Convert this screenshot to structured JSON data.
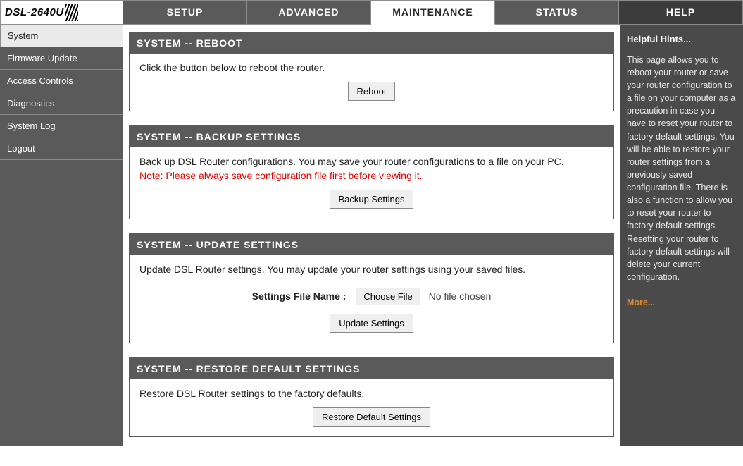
{
  "logo": {
    "model": "DSL-2640U"
  },
  "tabs": {
    "setup": "SETUP",
    "advanced": "ADVANCED",
    "maintenance": "MAINTENANCE",
    "status": "STATUS",
    "help": "HELP"
  },
  "sidebar": {
    "items": [
      {
        "label": "System"
      },
      {
        "label": "Firmware Update"
      },
      {
        "label": "Access Controls"
      },
      {
        "label": "Diagnostics"
      },
      {
        "label": "System Log"
      },
      {
        "label": "Logout"
      }
    ]
  },
  "panels": {
    "reboot": {
      "title": "SYSTEM -- REBOOT",
      "text": "Click the button below to reboot the router.",
      "button": "Reboot"
    },
    "backup": {
      "title": "SYSTEM -- BACKUP SETTINGS",
      "text": "Back up DSL Router configurations. You may save your router configurations to a file on your PC.",
      "note": "Note: Please always save configuration file first before viewing it.",
      "button": "Backup Settings"
    },
    "update": {
      "title": "SYSTEM -- UPDATE SETTINGS",
      "text": "Update DSL Router settings. You may update your router settings using your saved files.",
      "file_label": "Settings File Name :",
      "choose_button": "Choose File",
      "file_status": "No file chosen",
      "button": "Update Settings"
    },
    "restore": {
      "title": "SYSTEM -- RESTORE DEFAULT SETTINGS",
      "text": "Restore DSL Router settings to the factory defaults.",
      "button": "Restore Default Settings"
    }
  },
  "help": {
    "heading": "Helpful Hints...",
    "body": "This page allows you to reboot your router or save your router configuration to a file on your computer as a precaution in case you have to reset your router to factory default settings. You will be able to restore your router settings from a previously saved configuration file. There is also a function to allow you to reset your router to factory default settings. Resetting your router to factory default settings will delete your current configuration.",
    "more": "More..."
  }
}
